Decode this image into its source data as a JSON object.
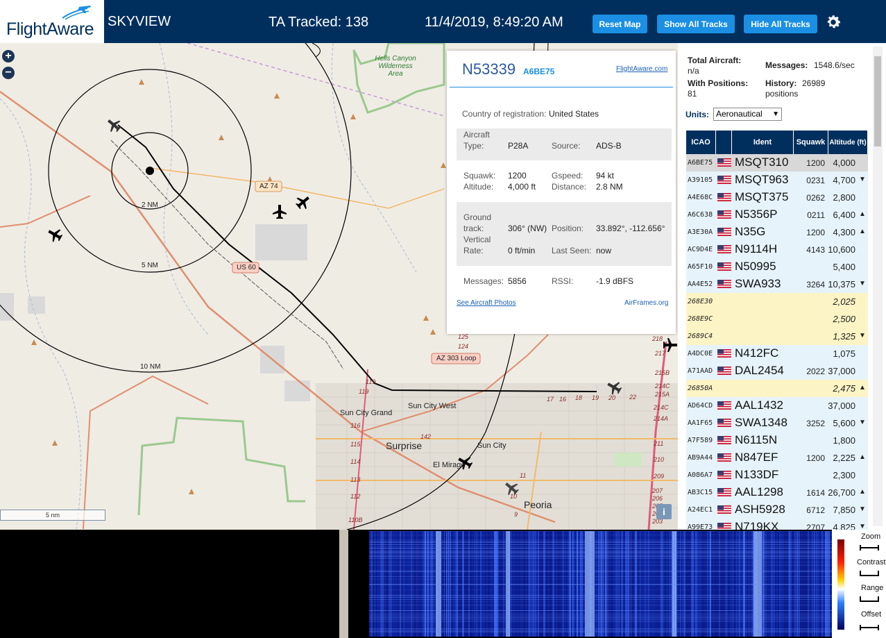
{
  "header": {
    "logo_text": "FlightAware",
    "app_title": "SKYVIEW",
    "tracked": "TA Tracked: 138",
    "datetime": "11/4/2019, 8:49:20 AM",
    "buttons": {
      "reset_map": "Reset Map",
      "show_all": "Show All Tracks",
      "hide_all": "Hide All Tracks"
    },
    "colors": {
      "bar": "#002f5d",
      "button": "#1a8fe3"
    }
  },
  "map": {
    "zoom_in": "+",
    "zoom_out": "−",
    "scale": "5 nm",
    "info": "i",
    "ring_labels": [
      "2 NM",
      "5 NM",
      "10 NM"
    ],
    "labels": {
      "hells_canyon": "Hells Canyon Wilderness Area",
      "az74": "AZ 74",
      "us60": "US 60",
      "az303": "AZ 303 Loop",
      "sun_city_west": "Sun City West",
      "sun_city_grand": "Sun City Grand",
      "surprise": "Surprise",
      "sun_city": "Sun City",
      "el_mirage": "El Mirage",
      "peoria": "Peoria"
    },
    "exits": [
      "125",
      "124",
      "119",
      "119",
      "116",
      "115",
      "114",
      "113",
      "112",
      "110B",
      "142",
      "17",
      "16",
      "18",
      "19",
      "20",
      "22",
      "11",
      "10",
      "9",
      "218",
      "217",
      "215B",
      "214C",
      "215A",
      "214C",
      "214A",
      "211",
      "210",
      "209",
      "207",
      "206",
      "205",
      "204",
      "203"
    ]
  },
  "popup": {
    "registration": "N53339",
    "hex": "A6BE75",
    "link": "FlightAware.com",
    "country_label": "Country of registration:",
    "country_value": "United States",
    "type_label1": "Aircraft",
    "type_label2": "Type:",
    "type_value": "P28A",
    "source_label": "Source:",
    "source_value": "ADS-B",
    "squawk_label": "Squawk:",
    "squawk_value": "1200",
    "gspeed_label": "Gspeed:",
    "gspeed_value": "94 kt",
    "altitude_label": "Altitude:",
    "altitude_value": "4,000 ft",
    "distance_label": "Distance:",
    "distance_value": "2.8 NM",
    "track_label1": "Ground",
    "track_label2": "track:",
    "track_value": "306° (NW)",
    "position_label": "Position:",
    "position_value": "33.892°, -112.656°",
    "vrate_label1": "Vertical",
    "vrate_label2": "Rate:",
    "vrate_value": "0 ft/min",
    "lastseen_label": "Last Seen:",
    "lastseen_value": "now",
    "messages_label": "Messages:",
    "messages_value": "5856",
    "rssi_label": "RSSI:",
    "rssi_value": "-1.9 dBFS",
    "photos_link": "See Aircraft Photos",
    "airframes_link": "AirFrames.org"
  },
  "panel": {
    "total_label": "Total Aircraft:",
    "total_value": "n/a",
    "messages_label": "Messages:",
    "messages_value": "1548.6/sec",
    "positions_label": "With Positions:",
    "positions_value": "81",
    "history_label": "History:",
    "history_value1": "26989",
    "history_value2": "positions",
    "units_label": "Units:",
    "units_value": "Aeronautical",
    "columns": [
      "ICAO",
      "",
      "Ident",
      "Squawk",
      "Altitude (ft)"
    ],
    "rows": [
      {
        "icao": "A6BE75",
        "flag": true,
        "ident": "MSQT310",
        "squawk": "1200",
        "alt": "4,000",
        "trend": "",
        "style": "sel"
      },
      {
        "icao": "A39105",
        "flag": true,
        "ident": "MSQT963",
        "squawk": "0231",
        "alt": "4,700",
        "trend": "▼",
        "style": "blue"
      },
      {
        "icao": "A4E68C",
        "flag": true,
        "ident": "MSQT375",
        "squawk": "0262",
        "alt": "2,800",
        "trend": "",
        "style": "blue"
      },
      {
        "icao": "A6C638",
        "flag": true,
        "ident": "N5356P",
        "squawk": "0211",
        "alt": "6,400",
        "trend": "▲",
        "style": "blue"
      },
      {
        "icao": "A3E30A",
        "flag": true,
        "ident": "N35G",
        "squawk": "1200",
        "alt": "4,300",
        "trend": "▲",
        "style": "blue"
      },
      {
        "icao": "AC9D4E",
        "flag": true,
        "ident": "N9114H",
        "squawk": "4143",
        "alt": "10,600",
        "trend": "",
        "style": "blue"
      },
      {
        "icao": "A65F10",
        "flag": true,
        "ident": "N50995",
        "squawk": "",
        "alt": "5,400",
        "trend": "",
        "style": "blue"
      },
      {
        "icao": "AA4E52",
        "flag": true,
        "ident": "SWA933",
        "squawk": "3264",
        "alt": "10,375",
        "trend": "▼",
        "style": "blue"
      },
      {
        "icao": "268E30",
        "flag": false,
        "ident": "",
        "squawk": "",
        "alt": "2,025",
        "trend": "",
        "style": "yellow"
      },
      {
        "icao": "268E9C",
        "flag": false,
        "ident": "",
        "squawk": "",
        "alt": "2,500",
        "trend": "",
        "style": "yellow"
      },
      {
        "icao": "2689C4",
        "flag": false,
        "ident": "",
        "squawk": "",
        "alt": "1,325",
        "trend": "▼",
        "style": "yellow"
      },
      {
        "icao": "A4DC0E",
        "flag": true,
        "ident": "N412FC",
        "squawk": "",
        "alt": "1,075",
        "trend": "",
        "style": "blue"
      },
      {
        "icao": "A71AAD",
        "flag": true,
        "ident": "DAL2454",
        "squawk": "2022",
        "alt": "37,000",
        "trend": "",
        "style": "blue"
      },
      {
        "icao": "26850A",
        "flag": false,
        "ident": "",
        "squawk": "",
        "alt": "2,475",
        "trend": "▲",
        "style": "yellow"
      },
      {
        "icao": "AD64CD",
        "flag": true,
        "ident": "AAL1432",
        "squawk": "",
        "alt": "37,000",
        "trend": "",
        "style": "blue"
      },
      {
        "icao": "AA1F65",
        "flag": true,
        "ident": "SWA1348",
        "squawk": "3252",
        "alt": "5,600",
        "trend": "▼",
        "style": "blue"
      },
      {
        "icao": "A7F589",
        "flag": true,
        "ident": "N6115N",
        "squawk": "",
        "alt": "1,800",
        "trend": "",
        "style": "blue"
      },
      {
        "icao": "AB9A44",
        "flag": true,
        "ident": "N847EF",
        "squawk": "1200",
        "alt": "2,225",
        "trend": "▲",
        "style": "blue"
      },
      {
        "icao": "A086A7",
        "flag": true,
        "ident": "N133DF",
        "squawk": "",
        "alt": "2,300",
        "trend": "",
        "style": "blue"
      },
      {
        "icao": "AB3C15",
        "flag": true,
        "ident": "AAL1298",
        "squawk": "1614",
        "alt": "26,700",
        "trend": "▲",
        "style": "blue"
      },
      {
        "icao": "A24EC1",
        "flag": true,
        "ident": "ASH5928",
        "squawk": "6712",
        "alt": "7,850",
        "trend": "▼",
        "style": "blue"
      },
      {
        "icao": "A99E73",
        "flag": true,
        "ident": "N719KX",
        "squawk": "2707",
        "alt": "4,825",
        "trend": "▼",
        "style": "blue"
      }
    ]
  },
  "spectrum": {
    "zoom_label": "Zoom",
    "contrast_label": "Contrast",
    "range_label": "Range",
    "offset_label": "Offset"
  }
}
